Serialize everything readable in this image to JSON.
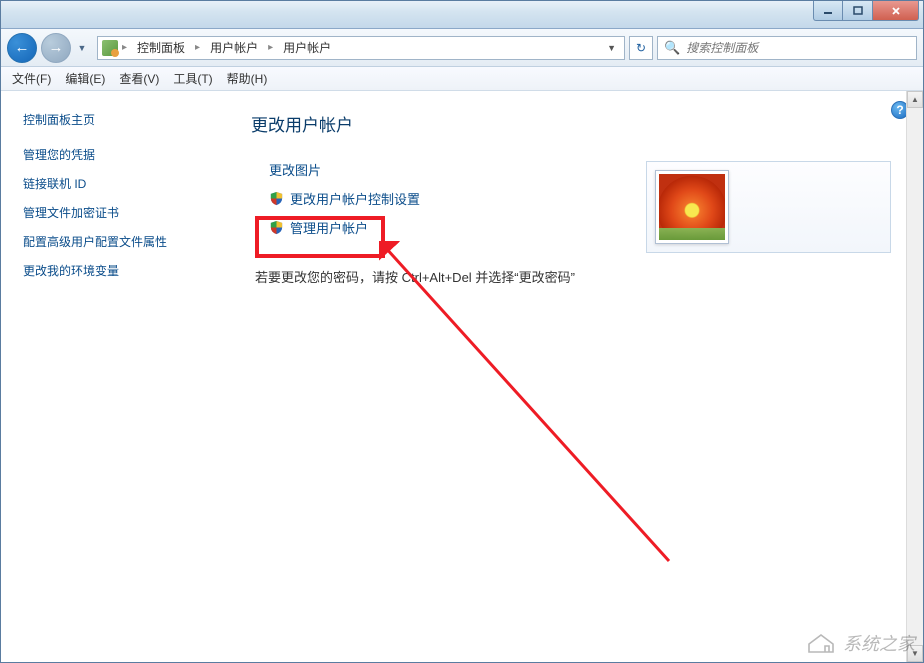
{
  "titlebar": {
    "min_tooltip": "最小化",
    "max_tooltip": "最大化",
    "close_tooltip": "关闭"
  },
  "nav": {
    "back_glyph": "←",
    "forward_glyph": "→",
    "refresh_glyph": "↻"
  },
  "breadcrumb": {
    "items": [
      "控制面板",
      "用户帐户",
      "用户帐户"
    ],
    "separator": "▸"
  },
  "search": {
    "placeholder": "搜索控制面板"
  },
  "menubar": {
    "items": [
      "文件(F)",
      "编辑(E)",
      "查看(V)",
      "工具(T)",
      "帮助(H)"
    ]
  },
  "sidebar": {
    "title": "控制面板主页",
    "links": [
      "管理您的凭据",
      "链接联机 ID",
      "管理文件加密证书",
      "配置高级用户配置文件属性",
      "更改我的环境变量"
    ]
  },
  "main": {
    "title": "更改用户帐户",
    "links": {
      "change_picture": "更改图片",
      "change_uac": "更改用户帐户控制设置",
      "manage_accounts": "管理用户帐户"
    },
    "instruction": "若要更改您的密码，请按 Ctrl+Alt+Del 并选择“更改密码”"
  },
  "help": {
    "glyph": "?"
  },
  "watermark": {
    "text": "系统之家"
  }
}
